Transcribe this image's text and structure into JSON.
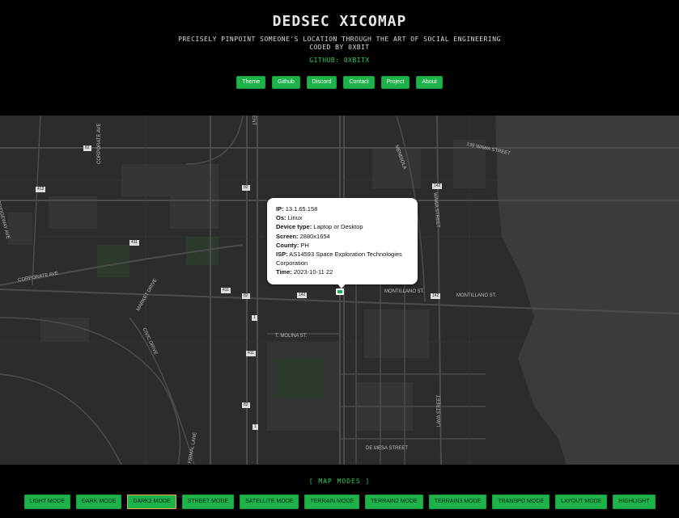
{
  "header": {
    "title": "DEDSEC XICOMAP",
    "subtitle_line1": "PRECISELY PINPOINT SOMEONE'S LOCATION THROUGH THE ART OF SOCIAL ENGINEERING",
    "subtitle_line2": "CODED BY 0XBIT",
    "github": "GITHUB: 0XBITX"
  },
  "nav": [
    "Theme",
    "Github",
    "Discord",
    "Contact",
    "Project",
    "About"
  ],
  "map": {
    "street_labels": [
      "CORPORATE AVE",
      "CORPORATE AVE",
      "BRIDGEWAY AVE",
      "MARKET DRIVE",
      "CIVIC DRIVE",
      "FIRMAL LANE",
      "T. MOLINA ST.",
      "MONTILLANO ST.",
      "MONTILLANO ST.",
      "MENDIOLA",
      "139 WAWA STREET",
      "WAWA STREET",
      "LAVA STREET",
      "DE MESA STREET",
      "ENT"
    ],
    "route_shields": [
      "411",
      "413",
      "411",
      "82",
      "142",
      "142",
      "142",
      "1",
      "411",
      "82",
      "1",
      "82",
      "82"
    ],
    "popup": {
      "ip_label": "IP:",
      "ip": "13.1.65.158",
      "os_label": "Os:",
      "os": "Linux",
      "device_label": "Device type:",
      "device": "Laptop or Desktop",
      "screen_label": "Screen:",
      "screen": "2880x1654",
      "county_label": "County:",
      "county": "PH",
      "isp_label": "ISP:",
      "isp": "AS14593 Space Exploration Technologies Corporation",
      "time_label": "Time:",
      "time": "2023-10-11 22"
    }
  },
  "modes": {
    "title": "[ MAP MODES ]",
    "buttons": [
      "LIGHT MODE",
      "DARK MODE",
      "DARK2 MODE",
      "STREET MODE",
      "SATELLITE MODE",
      "TERRAIN MODE",
      "TERRAIN2 MODE",
      "TERRAIN3 MODE",
      "TRANSPO MODE",
      "LAYOUT MODE",
      "HIGHLIGHT"
    ],
    "active": "DARK2 MODE"
  },
  "colors": {
    "accent": "#1db34a",
    "background": "#000000",
    "map_bg": "#2a2d2a",
    "water": "#3a3c3a"
  }
}
